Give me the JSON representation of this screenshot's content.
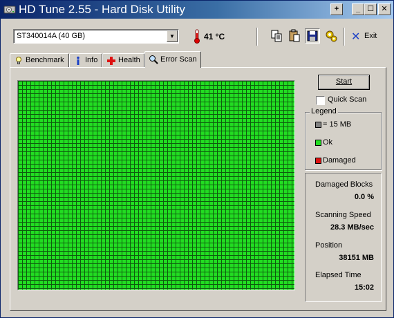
{
  "window": {
    "title": "HD Tune 2.55 - Hard Disk Utility",
    "controls": [
      "+",
      "_",
      "☐",
      "✕"
    ]
  },
  "toolbar": {
    "drive": "ST340014A (40 GB)",
    "temperature": "41 °C",
    "exit_label": "Exit",
    "icons": [
      "copy-icon",
      "paste-icon",
      "save-icon",
      "options-icon"
    ]
  },
  "tabs": [
    {
      "label": "Benchmark",
      "icon": "benchmark-icon",
      "active": false
    },
    {
      "label": "Info",
      "icon": "info-icon",
      "active": false
    },
    {
      "label": "Health",
      "icon": "health-icon",
      "active": false
    },
    {
      "label": "Error Scan",
      "icon": "magnifier-icon",
      "active": true
    }
  ],
  "scan": {
    "start_label": "Start",
    "quick_scan_label": "Quick Scan",
    "quick_scan_checked": false,
    "grid_color": "#22dd22"
  },
  "legend": {
    "title": "Legend",
    "items": [
      {
        "label": "= 15 MB",
        "color": "#808080"
      },
      {
        "label": "Ok",
        "color": "#22dd22"
      },
      {
        "label": "Damaged",
        "color": "#dd1111"
      }
    ]
  },
  "stats": [
    {
      "label": "Damaged Blocks",
      "value": "0.0 %"
    },
    {
      "label": "Scanning Speed",
      "value": "28.3 MB/sec"
    },
    {
      "label": "Position",
      "value": "38151 MB"
    },
    {
      "label": "Elapsed Time",
      "value": "15:02"
    }
  ]
}
